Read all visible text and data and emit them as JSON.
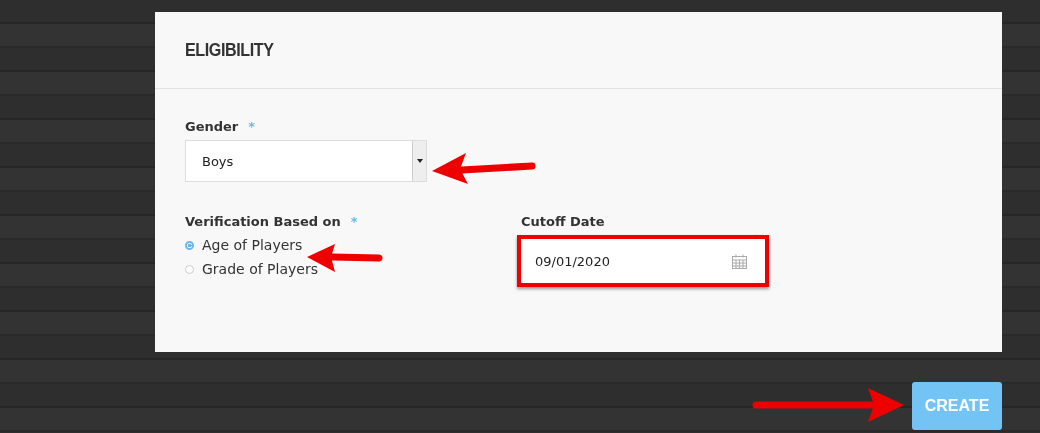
{
  "panel": {
    "title": "ELIGIBILITY"
  },
  "gender": {
    "label": "Gender",
    "required_mark": "*",
    "value": "Boys"
  },
  "verification": {
    "label": "Verification Based on",
    "required_mark": "*",
    "options": [
      {
        "label": "Age of Players",
        "selected": true
      },
      {
        "label": "Grade of Players",
        "selected": false
      }
    ]
  },
  "cutoff": {
    "label": "Cutoff Date",
    "value": "09/01/2020",
    "highlighted": true
  },
  "create_button": {
    "label": "CREATE"
  }
}
